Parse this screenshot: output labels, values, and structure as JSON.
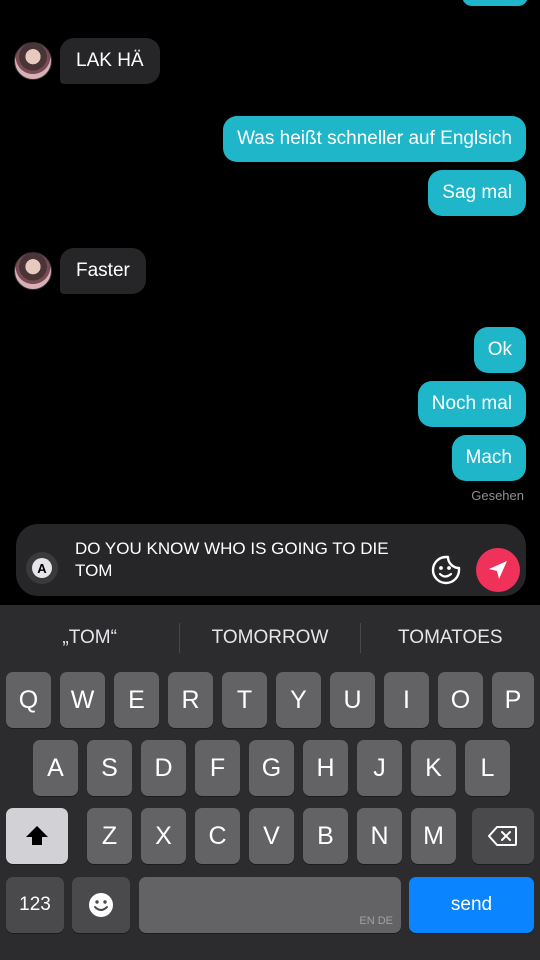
{
  "messages": {
    "incoming_1": "LAK HÄ",
    "outgoing_1": "Was heißt schneller auf Englsich",
    "outgoing_2": "Sag mal",
    "incoming_2": "Faster",
    "outgoing_3": "Ok",
    "outgoing_4": "Noch mal",
    "outgoing_5": "Mach",
    "seen_status": "Gesehen"
  },
  "composer": {
    "a_button": "A",
    "text": "DO YOU KNOW WHO IS GOING TO DIE TOM"
  },
  "suggestions": [
    "„TOM“",
    "TOMORROW",
    "TOMATOES"
  ],
  "keyboard": {
    "row1": [
      "Q",
      "W",
      "E",
      "R",
      "T",
      "Y",
      "U",
      "I",
      "O",
      "P"
    ],
    "row2": [
      "A",
      "S",
      "D",
      "F",
      "G",
      "H",
      "J",
      "K",
      "L"
    ],
    "row3": [
      "Z",
      "X",
      "C",
      "V",
      "B",
      "N",
      "M"
    ],
    "numbers_label": "123",
    "space_hint": "EN DE",
    "send_label": "send"
  },
  "colors": {
    "outgoing_bubble": "#1fb6c9",
    "incoming_bubble": "#262628",
    "send_button": "#f0315a",
    "keyboard_send": "#0a84ff"
  },
  "icons": {
    "shift": "shift-icon",
    "backspace": "backspace-icon",
    "emoji": "emoji-icon",
    "sticker": "sticker-icon",
    "send": "send-icon"
  }
}
